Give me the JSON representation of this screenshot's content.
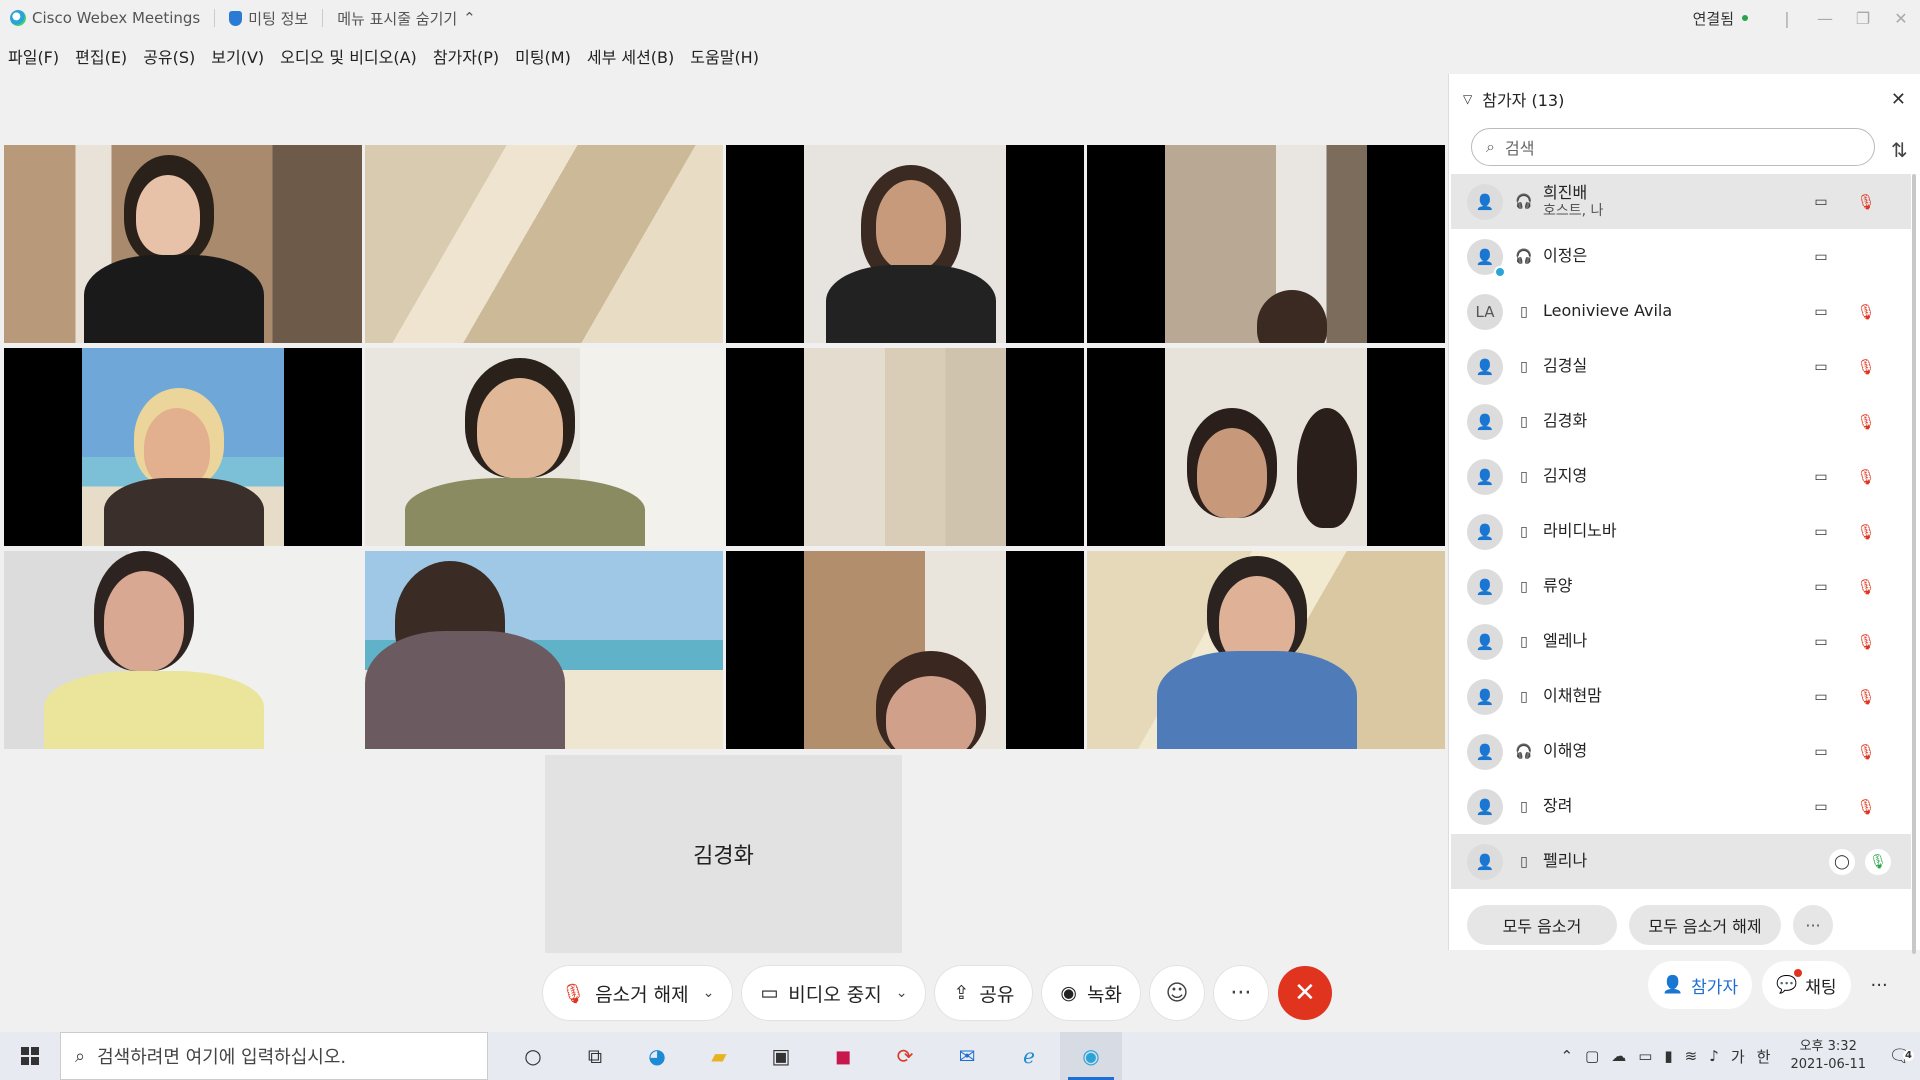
{
  "titlebar": {
    "app_name": "Cisco Webex Meetings",
    "meeting_info": "미팅 정보",
    "hide_menu": "메뉴 표시줄 숨기기",
    "connection": "연결됨"
  },
  "menu": [
    "파일(F)",
    "편집(E)",
    "공유(S)",
    "보기(V)",
    "오디오 및 비디오(A)",
    "참가자(P)",
    "미팅(M)",
    "세부 세션(B)",
    "도움말(H)"
  ],
  "solo_tile": {
    "name": "김경화"
  },
  "controls": {
    "unmute": "음소거 해제",
    "stop_video": "비디오 중지",
    "share": "공유",
    "record": "녹화"
  },
  "panel": {
    "title": "참가자 (13)",
    "search_placeholder": "검색",
    "participants": [
      {
        "name": "희진배",
        "sub": "호스트, 나",
        "initials": "",
        "device": "headset",
        "camera": true,
        "mic": "muted"
      },
      {
        "name": "이정은",
        "sub": "",
        "initials": "",
        "device": "headset",
        "camera": true,
        "mic": "none"
      },
      {
        "name": "Leonivieve Avila",
        "sub": "",
        "initials": "LA",
        "device": "phone",
        "camera": true,
        "mic": "muted"
      },
      {
        "name": "김경실",
        "sub": "",
        "initials": "",
        "device": "phone",
        "camera": true,
        "mic": "muted"
      },
      {
        "name": "김경화",
        "sub": "",
        "initials": "",
        "device": "phone",
        "camera": false,
        "mic": "muted"
      },
      {
        "name": "김지영",
        "sub": "",
        "initials": "",
        "device": "phone",
        "camera": true,
        "mic": "muted"
      },
      {
        "name": "라비디노바",
        "sub": "",
        "initials": "",
        "device": "phone",
        "camera": true,
        "mic": "muted"
      },
      {
        "name": "류양",
        "sub": "",
        "initials": "",
        "device": "phone",
        "camera": true,
        "mic": "muted"
      },
      {
        "name": "엘레나",
        "sub": "",
        "initials": "",
        "device": "phone",
        "camera": true,
        "mic": "muted"
      },
      {
        "name": "이채현맘",
        "sub": "",
        "initials": "",
        "device": "phone",
        "camera": true,
        "mic": "muted"
      },
      {
        "name": "이해영",
        "sub": "",
        "initials": "",
        "device": "headset",
        "camera": true,
        "mic": "muted"
      },
      {
        "name": "장려",
        "sub": "",
        "initials": "",
        "device": "phone",
        "camera": true,
        "mic": "muted"
      },
      {
        "name": "펠리나",
        "sub": "",
        "initials": "",
        "device": "phone",
        "camera": false,
        "mic": "on"
      }
    ],
    "mute_all": "모두 음소거",
    "unmute_all": "모두 음소거 해제"
  },
  "panel_tabs": {
    "participants": "참가자",
    "chat": "채팅"
  },
  "taskbar": {
    "search_placeholder": "검색하려면 여기에 입력하십시오.",
    "ime_lang": "가",
    "ime_mode": "한",
    "time": "오후 3:32",
    "date": "2021-06-11",
    "notifications": "4"
  },
  "colors": {
    "accent": "#1d6fd3",
    "danger": "#e0341f",
    "ok": "#2aa44a"
  }
}
